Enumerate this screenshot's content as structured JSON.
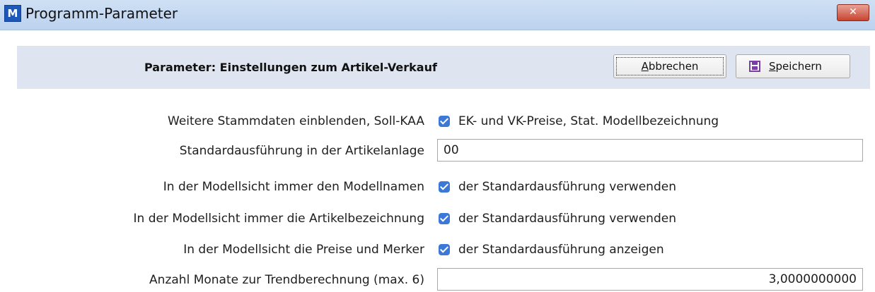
{
  "window": {
    "app_icon_letter": "M",
    "title": "Programm-Parameter",
    "close_glyph": "✕"
  },
  "header": {
    "title": "Parameter: Einstellungen zum Artikel-Verkauf",
    "cancel_label_accel": "A",
    "cancel_label_rest": "bbrechen",
    "save_label_accel": "S",
    "save_label_rest": "peichern",
    "save_icon": "floppy-disk-icon"
  },
  "rows": [
    {
      "label": "Weitere Stammdaten einblenden, Soll-KAA",
      "type": "checkbox",
      "checked": true,
      "text": "EK- und VK-Preise, Stat. Modellbezeichnung"
    },
    {
      "label": "Standardausführung in der Artikelanlage",
      "type": "text",
      "value": "00"
    },
    {
      "label": "In der Modellsicht immer den Modellnamen",
      "type": "checkbox",
      "checked": true,
      "text": "der Standardausführung verwenden"
    },
    {
      "label": "In der Modellsicht immer die Artikelbezeichnung",
      "type": "checkbox",
      "checked": true,
      "text": "der Standardausführung verwenden"
    },
    {
      "label": "In der Modellsicht die Preise und Merker",
      "type": "checkbox",
      "checked": true,
      "text": "der Standardausführung anzeigen"
    },
    {
      "label": "Anzahl Monate zur Trendberechnung (max. 6)",
      "type": "number",
      "value": "3,0000000000"
    }
  ],
  "colors": {
    "accent": "#3b78d8",
    "header_band": "#dfe4f1",
    "titlebar": "#c6dbf2",
    "close": "#c8442f"
  }
}
